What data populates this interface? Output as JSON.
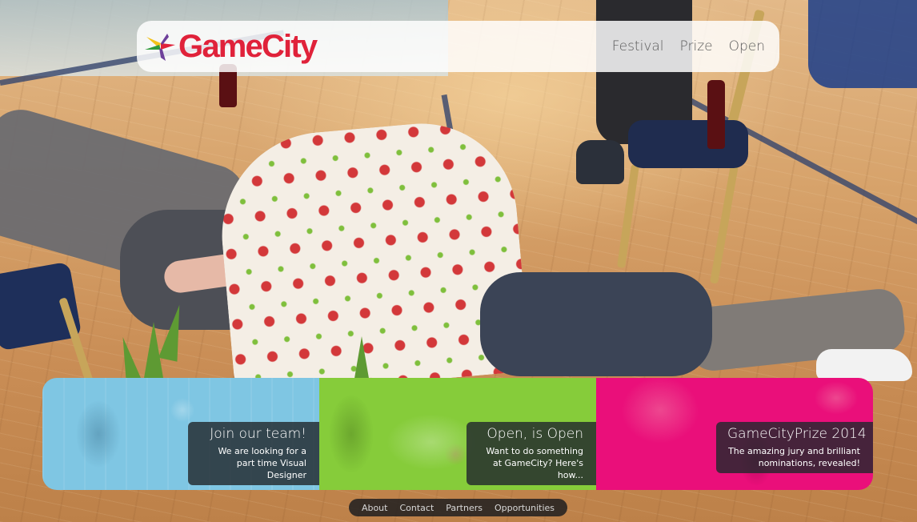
{
  "brand": {
    "name": "GameCity",
    "color": "#e0223a",
    "mark_colors": [
      "#2f9a3b",
      "#f4c21a",
      "#6d3f9a",
      "#e0223a"
    ]
  },
  "nav": {
    "items": [
      {
        "label": "Festival"
      },
      {
        "label": "Prize"
      },
      {
        "label": "Open"
      }
    ]
  },
  "tiles": [
    {
      "title": "Join our team!",
      "text": "We are looking for a part time Visual Designer",
      "color": "#7fc6e3"
    },
    {
      "title": "Open, is Open",
      "text": "Want to do something at GameCity? Here's how...",
      "color": "#86cc3a"
    },
    {
      "title": "GameCityPrize 2014",
      "text": "The amazing jury and brilliant nominations, revealed!",
      "color": "#ea0f7a"
    }
  ],
  "footer": {
    "links": [
      {
        "label": "About"
      },
      {
        "label": "Contact"
      },
      {
        "label": "Partners"
      },
      {
        "label": "Opportunities"
      }
    ]
  }
}
